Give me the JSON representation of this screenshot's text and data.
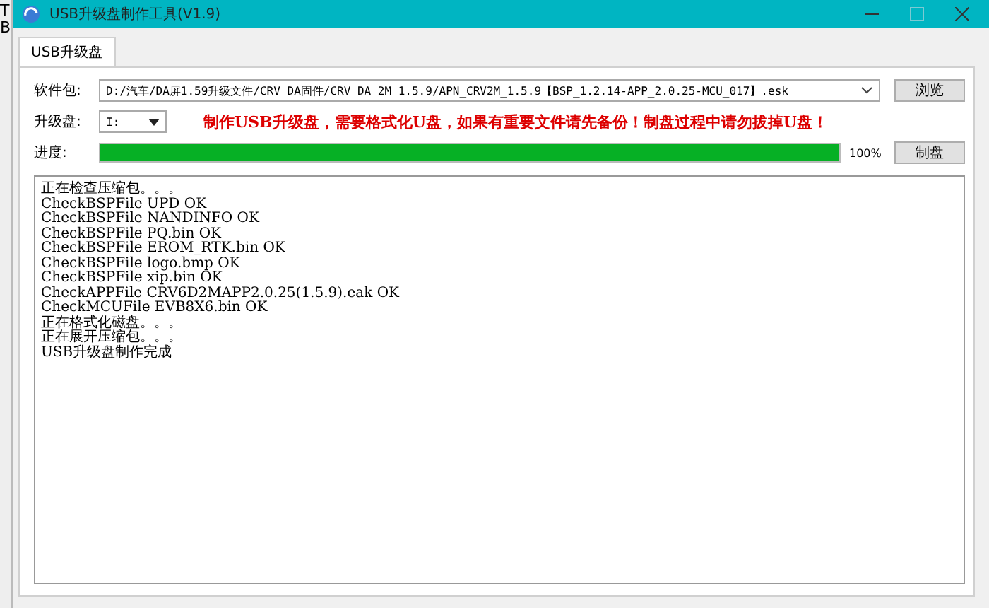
{
  "background_letters": [
    "T",
    "B"
  ],
  "window": {
    "title": "USB升级盘制作工具(V1.9)"
  },
  "tabs": [
    {
      "label": "USB升级盘",
      "selected": true
    }
  ],
  "package": {
    "label": "软件包:",
    "value": "D:/汽车/DA屏1.59升级文件/CRV DA固件/CRV DA 2M 1.5.9/APN_CRV2M_1.5.9【BSP_1.2.14-APP_2.0.25-MCU_017】.esk",
    "browse_button": "浏览"
  },
  "drive": {
    "label": "升级盘:",
    "value": "I:"
  },
  "warning": "制作USB升级盘，需要格式化U盘，如果有重要文件请先备份！制盘过程中请勿拔掉U盘！",
  "progress": {
    "label": "进度:",
    "level": 1.0,
    "reading": "100%",
    "button": "制盘"
  },
  "log": [
    "正在检查压缩包。。。",
    "CheckBSPFile UPD OK",
    "CheckBSPFile NANDINFO OK",
    "CheckBSPFile PQ.bin OK",
    "CheckBSPFile EROM_RTK.bin OK",
    "CheckBSPFile logo.bmp OK",
    "CheckBSPFile xip.bin OK",
    "CheckAPPFile CRV6D2MAPP2.0.25(1.5.9).eak OK",
    "CheckMCUFile EVB8X6.bin OK",
    "正在格式化磁盘。。。",
    "正在展开压缩包。。。",
    "USB升级盘制作完成"
  ]
}
